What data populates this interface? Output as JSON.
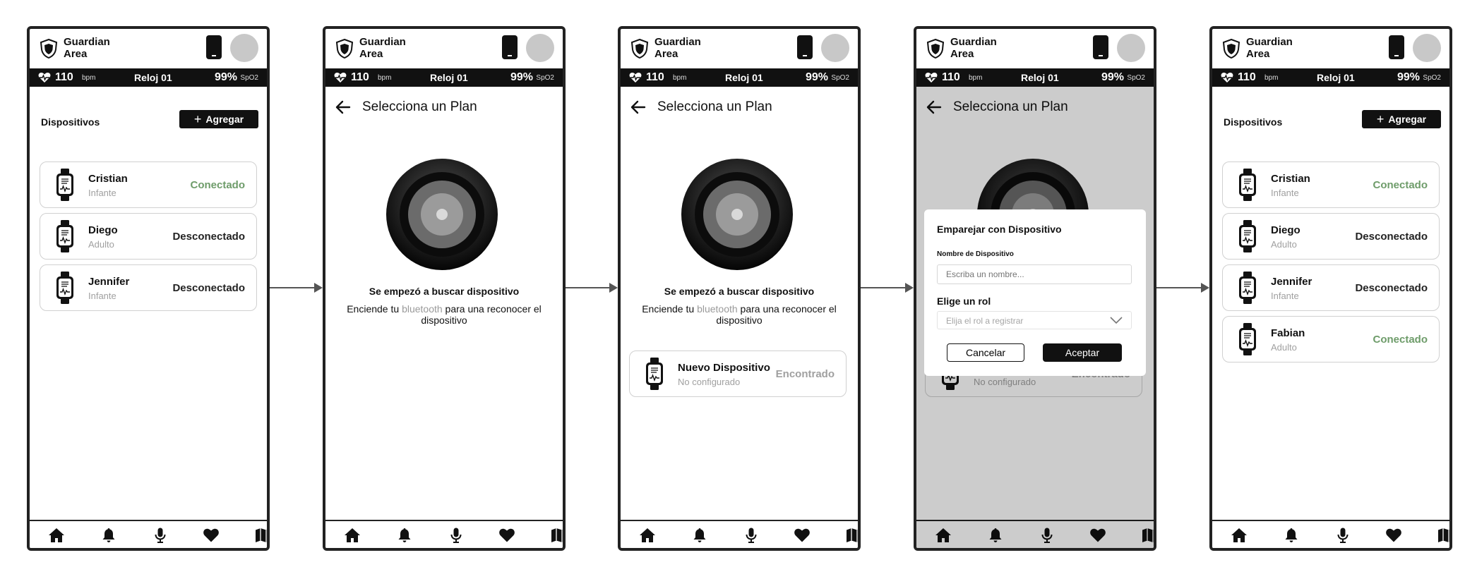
{
  "header": {
    "brand_line1": "Guardian",
    "brand_line2": "Area"
  },
  "statusbar": {
    "bpm_value": "110",
    "bpm_unit": "bpm",
    "watch_name": "Reloj 01",
    "spo2_value": "99%",
    "spo2_unit": "SpO2"
  },
  "devices_screen": {
    "title": "Dispositivos",
    "add_plus": "+",
    "add_label": "Agregar"
  },
  "devices_initial": [
    {
      "name": "Cristian",
      "role": "Infante",
      "status": "Conectado",
      "status_color": "#6e9c6a"
    },
    {
      "name": "Diego",
      "role": "Adulto",
      "status": "Desconectado",
      "status_color": "#222222"
    },
    {
      "name": "Jennifer",
      "role": "Infante",
      "status": "Desconectado",
      "status_color": "#222222"
    }
  ],
  "devices_final": [
    {
      "name": "Cristian",
      "role": "Infante",
      "status": "Conectado",
      "status_color": "#6e9c6a"
    },
    {
      "name": "Diego",
      "role": "Adulto",
      "status": "Desconectado",
      "status_color": "#222222"
    },
    {
      "name": "Jennifer",
      "role": "Infante",
      "status": "Desconectado",
      "status_color": "#222222"
    },
    {
      "name": "Fabian",
      "role": "Adulto",
      "status": "Conectado",
      "status_color": "#6e9c6a"
    }
  ],
  "plan_screen": {
    "title": "Selecciona un Plan",
    "search_title": "Se empezó a buscar dispositivo",
    "sub_before": "Enciende tu ",
    "sub_bt": "bluetooth",
    "sub_after": " para una reconocer el dispositivo"
  },
  "new_device": {
    "name": "Nuevo Dispositivo",
    "status_text": "No configurado",
    "found_label": "Encontrado"
  },
  "pair_dialog": {
    "title": "Emparejar con Dispositivo",
    "name_label": "Nombre de Dispositivo",
    "name_placeholder": "Escriba un nombre...",
    "role_label": "Elige un rol",
    "role_placeholder": "Elija el rol a registrar",
    "cancel_label": "Cancelar",
    "accept_label": "Aceptar"
  },
  "nav_items": [
    "home-icon",
    "bell-icon",
    "microphone-icon",
    "heart-icon",
    "map-icon"
  ],
  "colors": {
    "connected": "#6e9c6a",
    "disconnected": "#222222",
    "muted": "#a0a0a0",
    "primary": "#111111"
  }
}
